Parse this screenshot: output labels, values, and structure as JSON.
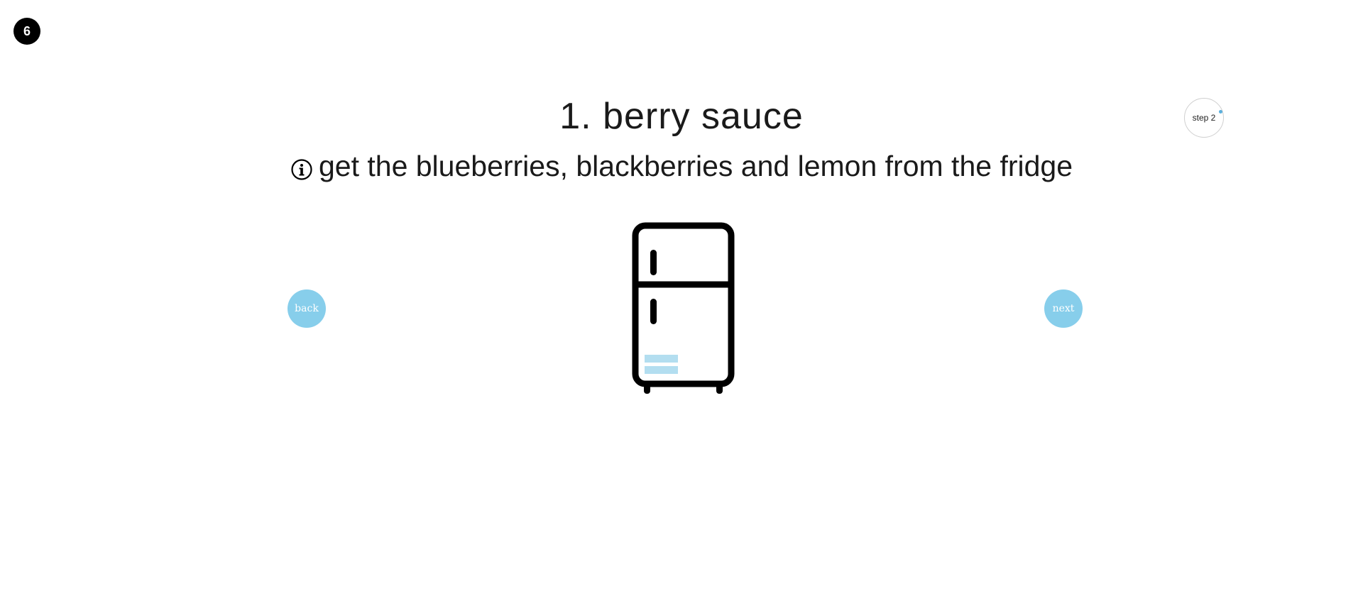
{
  "header": {
    "step_number": "6"
  },
  "recipe": {
    "section_title": "1. berry sauce",
    "instruction": "get the blueberries, blackberries and lemon from the fridge"
  },
  "progress": {
    "next_step_label": "step 2",
    "accent_color": "#5aafdc"
  },
  "navigation": {
    "back_label": "back",
    "next_label": "next",
    "button_color": "#87ceeb"
  },
  "illustration": {
    "icon": "fridge-icon",
    "shelf_color": "#b3def0"
  }
}
